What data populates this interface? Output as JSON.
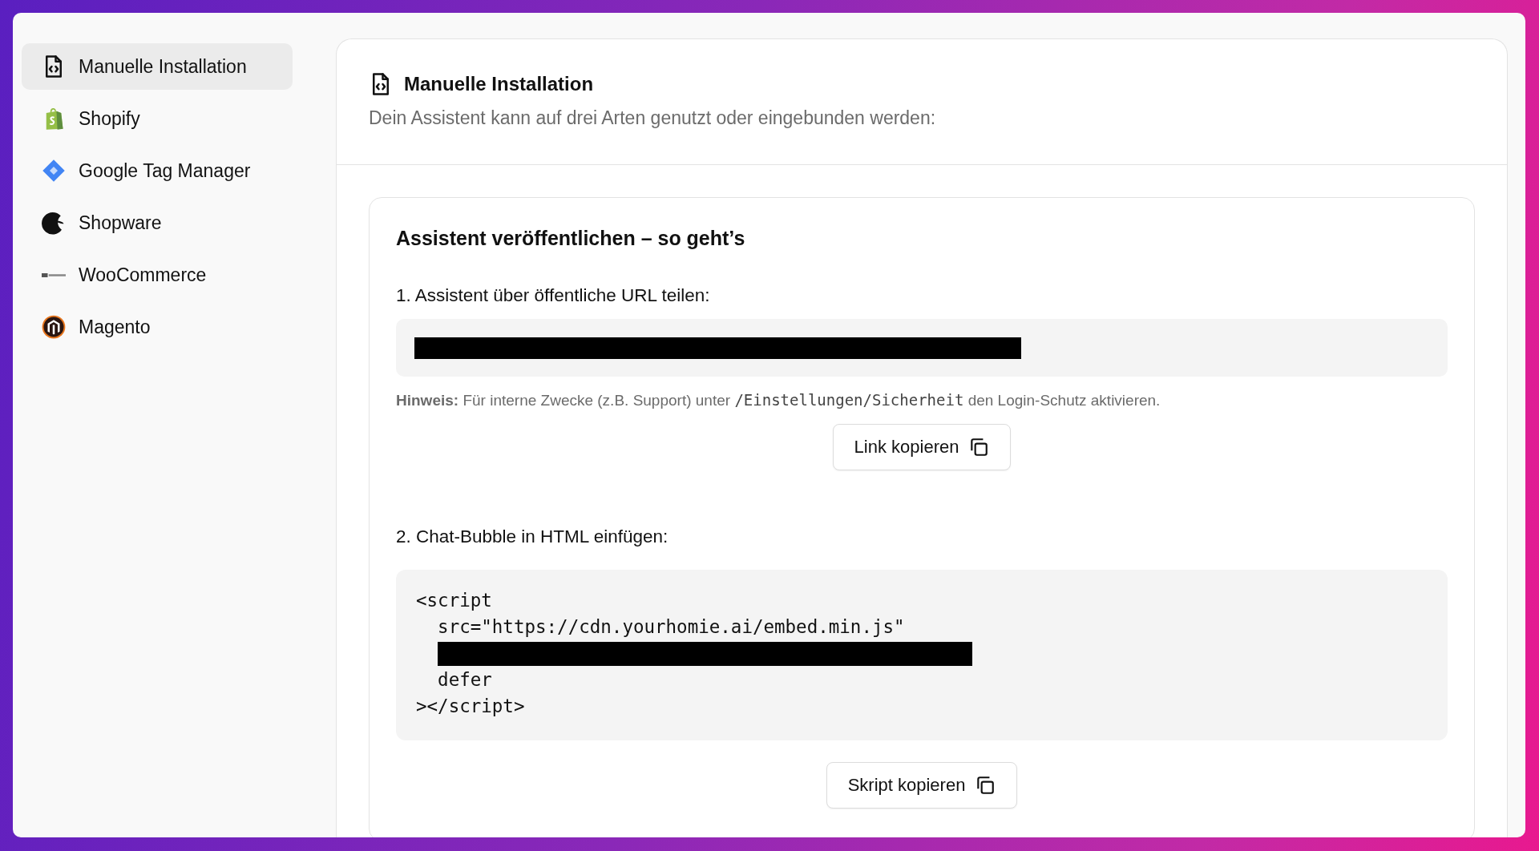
{
  "sidebar": {
    "items": [
      {
        "label": "Manuelle Installation",
        "selected": true
      },
      {
        "label": "Shopify",
        "selected": false
      },
      {
        "label": "Google Tag Manager",
        "selected": false
      },
      {
        "label": "Shopware",
        "selected": false
      },
      {
        "label": "WooCommerce",
        "selected": false
      },
      {
        "label": "Magento",
        "selected": false
      }
    ]
  },
  "header": {
    "title": "Manuelle Installation",
    "subtitle": "Dein Assistent kann auf drei Arten genutzt oder eingebunden werden:"
  },
  "card": {
    "title": "Assistent veröffentlichen – so geht’s",
    "step_1": {
      "label": "1. Assistent über öffentliche URL teilen:",
      "url_redacted": true,
      "hint": {
        "label": "Hinweis:",
        "before": "Für interne Zwecke (z.B. Support) unter",
        "path": "/Einstellungen/Sicherheit",
        "after": "den Login-Schutz aktivieren."
      },
      "button": "Link kopieren"
    },
    "step_2": {
      "label": "2. Chat-Bubble in HTML einfügen:",
      "code_lines": [
        {
          "kind": "text",
          "text": "<script"
        },
        {
          "kind": "text",
          "text": "  src=\"https://cdn.yourhomie.ai/embed.min.js\""
        },
        {
          "kind": "redacted"
        },
        {
          "kind": "text",
          "text": "  defer"
        },
        {
          "kind": "text",
          "text": "></script>"
        }
      ],
      "button": "Skript kopieren"
    }
  }
}
